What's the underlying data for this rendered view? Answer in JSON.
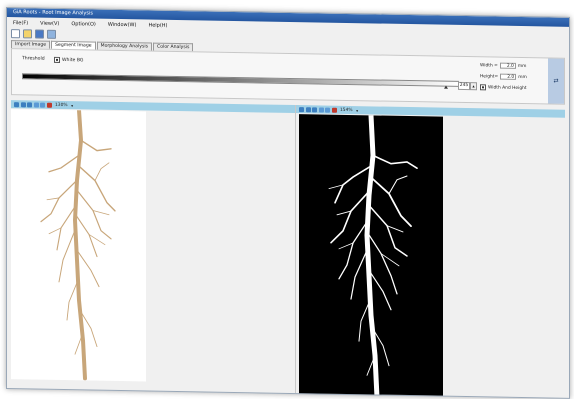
{
  "window": {
    "title": "GiA Roots - Root Image Analysis",
    "menu": [
      "File(F)",
      "View(V)",
      "Option(O)",
      "Window(W)",
      "Help(H)"
    ]
  },
  "toolbar": {
    "icons": [
      "new-file-icon",
      "open-folder-icon",
      "save-icon",
      "print-icon"
    ]
  },
  "tabs": [
    "Import Image",
    "Segment Image",
    "Morphology Analysis",
    "Color Analysis"
  ],
  "active_tab": "Segment Image",
  "segment": {
    "threshold_label": "Threshold",
    "white_bg_label": "White BG",
    "white_bg_checked": true,
    "threshold_value": "245",
    "threshold_level": 245,
    "width_label": "Width =",
    "width_value": "2.0",
    "width_unit": "mm",
    "height_label": "Height=",
    "height_value": "2.0",
    "height_unit": "mm",
    "wh_label": "Width And Height",
    "wh_checked": true,
    "apply_symbol": "⇄"
  },
  "left_view": {
    "zoom": "130%"
  },
  "right_view": {
    "zoom": "154%"
  },
  "colors": {
    "accent_bar": "#9fd0e6",
    "root_color": "#c8a67a"
  }
}
